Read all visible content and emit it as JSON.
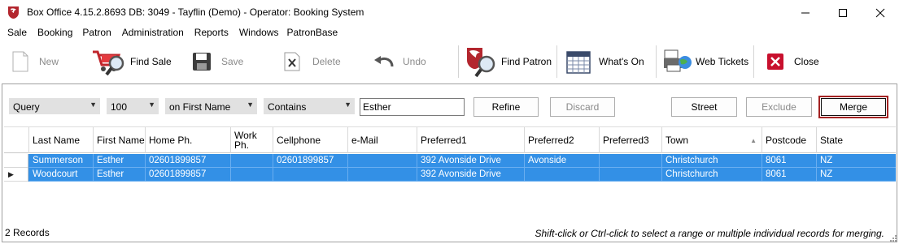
{
  "window": {
    "title": "Box Office 4.15.2.8693 DB: 3049 - Tayflin (Demo) - Operator: Booking System"
  },
  "menu": [
    "Sale",
    "Booking",
    "Patron",
    "Administration",
    "Reports",
    "Windows",
    "PatronBase"
  ],
  "toolbar": {
    "new": "New",
    "find_sale": "Find Sale",
    "save": "Save",
    "delete": "Delete",
    "undo": "Undo",
    "find_patron": "Find Patron",
    "whats_on": "What's On",
    "web_tickets": "Web Tickets",
    "close": "Close"
  },
  "filter": {
    "query_combo": "Query",
    "limit_combo": "100",
    "field_combo": "on First Name",
    "operator_combo": "Contains",
    "search_value": "Esther",
    "refine": "Refine",
    "discard": "Discard",
    "street": "Street",
    "exclude": "Exclude",
    "merge": "Merge"
  },
  "grid": {
    "columns": [
      "Last Name",
      "First Name",
      "Home Ph.",
      "Work Ph.",
      "Cellphone",
      "e-Mail",
      "Preferred1",
      "Preferred2",
      "Preferred3",
      "Town",
      "Postcode",
      "State"
    ],
    "rows": [
      [
        "Summerson",
        "Esther",
        "02601899857",
        "",
        "02601899857",
        "",
        "392 Avonside Drive",
        "Avonside",
        "",
        "Christchurch",
        "8061",
        "NZ"
      ],
      [
        "Woodcourt",
        "Esther",
        "02601899857",
        "",
        "",
        "",
        "392 Avonside Drive",
        "",
        "",
        "Christchurch",
        "8061",
        "NZ"
      ]
    ]
  },
  "status": {
    "record_count": "2 Records",
    "hint": "Shift-click or Ctrl-click to select a range or multiple individual records for merging."
  }
}
